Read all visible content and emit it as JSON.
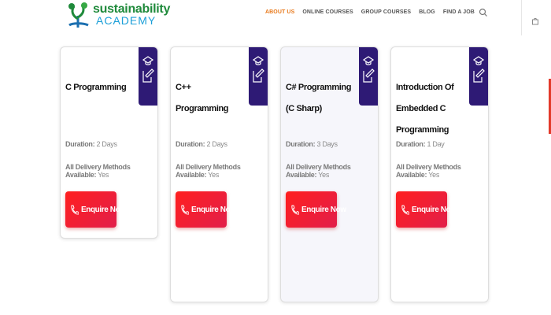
{
  "logo": {
    "line1": "sustainability",
    "line2": "ACADEMY"
  },
  "nav": [
    {
      "label": "ABOUT US",
      "active": true
    },
    {
      "label": "ONLINE COURSES",
      "active": false
    },
    {
      "label": "GROUP COURSES",
      "active": false
    },
    {
      "label": "BLOG",
      "active": false
    },
    {
      "label": "FIND A JOB",
      "active": false
    }
  ],
  "colors": {
    "accent_orange": "#e8791b",
    "badge": "#2e1a75",
    "button": "#ff1f1f",
    "logo_green": "#1f8a3b",
    "logo_blue": "#1b9fd8"
  },
  "cards": [
    {
      "title": "C Programming",
      "duration_label": "Duration:",
      "duration": "2 Days",
      "delivery_label": "All Delivery Methods Available:",
      "delivery": "Yes",
      "button": "Enquire Now"
    },
    {
      "title": "C++ Programming",
      "duration_label": "Duration:",
      "duration": "2 Days",
      "delivery_label": "All Delivery Methods Available:",
      "delivery": "Yes",
      "button": "Enquire Now"
    },
    {
      "title": "C# Programming (C Sharp)",
      "duration_label": "Duration:",
      "duration": "3 Days",
      "delivery_label": "All Delivery Methods Available:",
      "delivery": "Yes",
      "button": "Enquire Now"
    },
    {
      "title": "Introduction Of Embedded C Programming",
      "duration_label": "Duration:",
      "duration": "1 Day",
      "delivery_label": "All Delivery Methods Available:",
      "delivery": "Yes",
      "button": "Enquire Now"
    }
  ]
}
